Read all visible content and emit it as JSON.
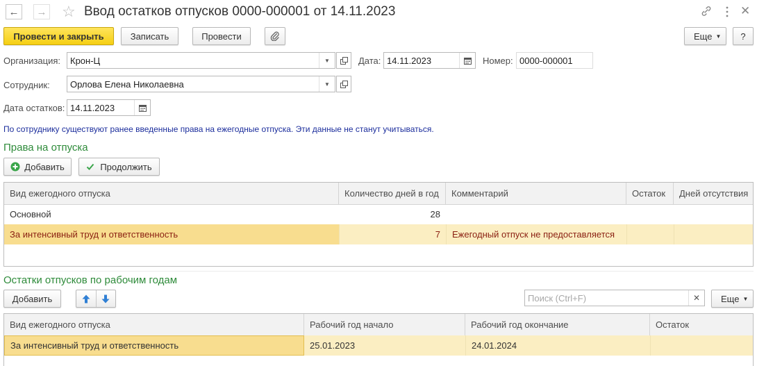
{
  "window": {
    "title": "Ввод остатков отпусков 0000-000001 от 14.11.2023"
  },
  "toolbar": {
    "post_close": "Провести и закрыть",
    "save": "Записать",
    "post": "Провести",
    "more": "Еще",
    "help": "?"
  },
  "form": {
    "org_label": "Организация:",
    "org_value": "Крон-Ц",
    "date_label": "Дата:",
    "date_value": "14.11.2023",
    "number_label": "Номер:",
    "number_value": "0000-000001",
    "employee_label": "Сотрудник:",
    "employee_value": "Орлова Елена Николаевна",
    "balance_date_label": "Дата остатков:",
    "balance_date_value": "14.11.2023"
  },
  "info_message": "По сотруднику существуют ранее введенные права на ежегодные отпуска. Эти данные не станут учитываться.",
  "rights": {
    "title": "Права на отпуска",
    "add": "Добавить",
    "continue": "Продолжить",
    "columns": [
      "Вид ежегодного отпуска",
      "Количество дней в год",
      "Комментарий",
      "Остаток",
      "Дней отсутствия"
    ],
    "rows": [
      {
        "kind": "Основной",
        "days": "28",
        "comment": "",
        "remainder": "",
        "absence": ""
      },
      {
        "kind": "За интенсивный труд и ответственность",
        "days": "7",
        "comment": "Ежегодный отпуск не предоставляется",
        "remainder": "",
        "absence": ""
      }
    ]
  },
  "balances": {
    "title": "Остатки отпусков по рабочим годам",
    "add": "Добавить",
    "search_placeholder": "Поиск (Ctrl+F)",
    "more": "Еще",
    "columns": [
      "Вид ежегодного отпуска",
      "Рабочий год начало",
      "Рабочий год окончание",
      "Остаток"
    ],
    "rows": [
      {
        "kind": "За интенсивный труд и ответственность",
        "start": "25.01.2023",
        "end": "24.01.2024",
        "remainder": ""
      }
    ]
  },
  "icons": {
    "back": "arrow-left-icon",
    "forward": "arrow-right-icon",
    "favorite": "star-icon",
    "link": "link-icon",
    "menu": "vertical-dots-icon",
    "close": "close-icon",
    "attach": "paperclip-icon",
    "add": "plus-circle-icon",
    "continue": "checkmark-icon",
    "up": "arrow-up-icon",
    "down": "arrow-down-icon"
  },
  "colors": {
    "primary_button": "#f5cf13",
    "section_title": "#2e8b3a",
    "info_text": "#1b2d9c",
    "selected_row": "#fbeec2",
    "warning_text": "#8a1f11"
  }
}
